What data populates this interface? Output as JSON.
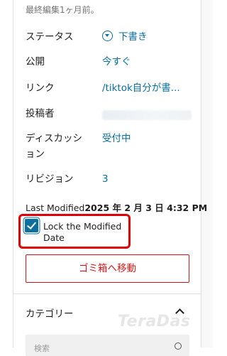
{
  "panel": {
    "last_edited": "最終編集1ヶ月前。",
    "rows": [
      {
        "label": "ステータス",
        "value": "下書き",
        "icon": "status-chevron-icon"
      },
      {
        "label": "公開",
        "value": "今すぐ"
      },
      {
        "label": "リンク",
        "value": "/tiktok自分が書..."
      },
      {
        "label": "投稿者",
        "value": ""
      },
      {
        "label": "ディスカッション",
        "value": "受付中"
      },
      {
        "label": "リビジョン",
        "value": "3"
      }
    ],
    "last_modified_label": "Last Modified",
    "last_modified_value": "2025 年 2 月 3 日 4:32 PM",
    "lock_checkbox_label": "Lock the Modified Date",
    "lock_checkbox_checked": true,
    "trash_button_label": "ゴミ箱へ移動",
    "category_title": "カテゴリー",
    "search_placeholder": "検索"
  },
  "watermark": "TeraDas",
  "colors": {
    "accent": "#0a6e9e",
    "danger": "#cc1818",
    "highlight": "#e00000"
  }
}
